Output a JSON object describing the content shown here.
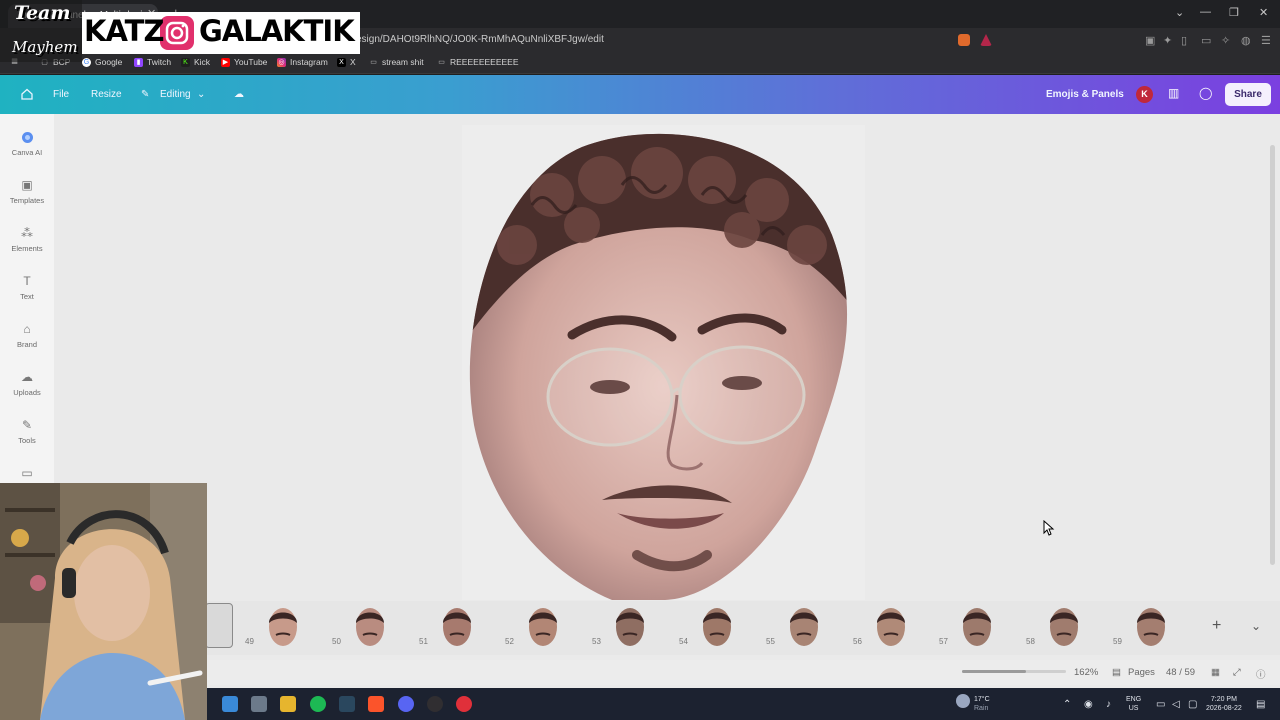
{
  "browser": {
    "tab_title": "Emojis & Panels - Multi-design",
    "url": "esign/DAHOt9RlhNQ/JO0K-RmMhAQuNnliXBFJgw/edit",
    "bookmarks": [
      "BCP",
      "Google",
      "Twitch",
      "Kick",
      "YouTube",
      "Instagram",
      "X",
      "stream shit",
      "REEEEEEEEEEE"
    ]
  },
  "overlay": {
    "team_line1": "Team",
    "team_line2": "Mayhem",
    "handle_part": "KATZ",
    "handle_main": "GALAKTIK"
  },
  "canva": {
    "menu": {
      "file": "File",
      "resize": "Resize",
      "editing": "Editing"
    },
    "design_title": "Emojis & Panels",
    "avatar_initial": "K",
    "share": "Share",
    "sidebar": [
      {
        "label": "Canva AI",
        "icon": "canva-ai-icon"
      },
      {
        "label": "Templates",
        "icon": "templates-icon"
      },
      {
        "label": "Elements",
        "icon": "elements-icon"
      },
      {
        "label": "Text",
        "icon": "text-icon"
      },
      {
        "label": "Brand",
        "icon": "brand-icon"
      },
      {
        "label": "Uploads",
        "icon": "uploads-icon"
      },
      {
        "label": "Tools",
        "icon": "tools-icon"
      }
    ],
    "thumbnails": [
      "49",
      "50",
      "51",
      "52",
      "53",
      "54",
      "55",
      "56",
      "57",
      "58",
      "59"
    ],
    "zoom_value": 0.62,
    "zoom_label": "162%",
    "pages_label": "Pages",
    "page_counter": "48 / 59"
  },
  "taskbar": {
    "weather_temp": "17°C",
    "weather_desc": "Rain",
    "lang_line1": "ENG",
    "lang_line2": "US",
    "time": "7:20 PM",
    "date": "2026-08-22"
  }
}
